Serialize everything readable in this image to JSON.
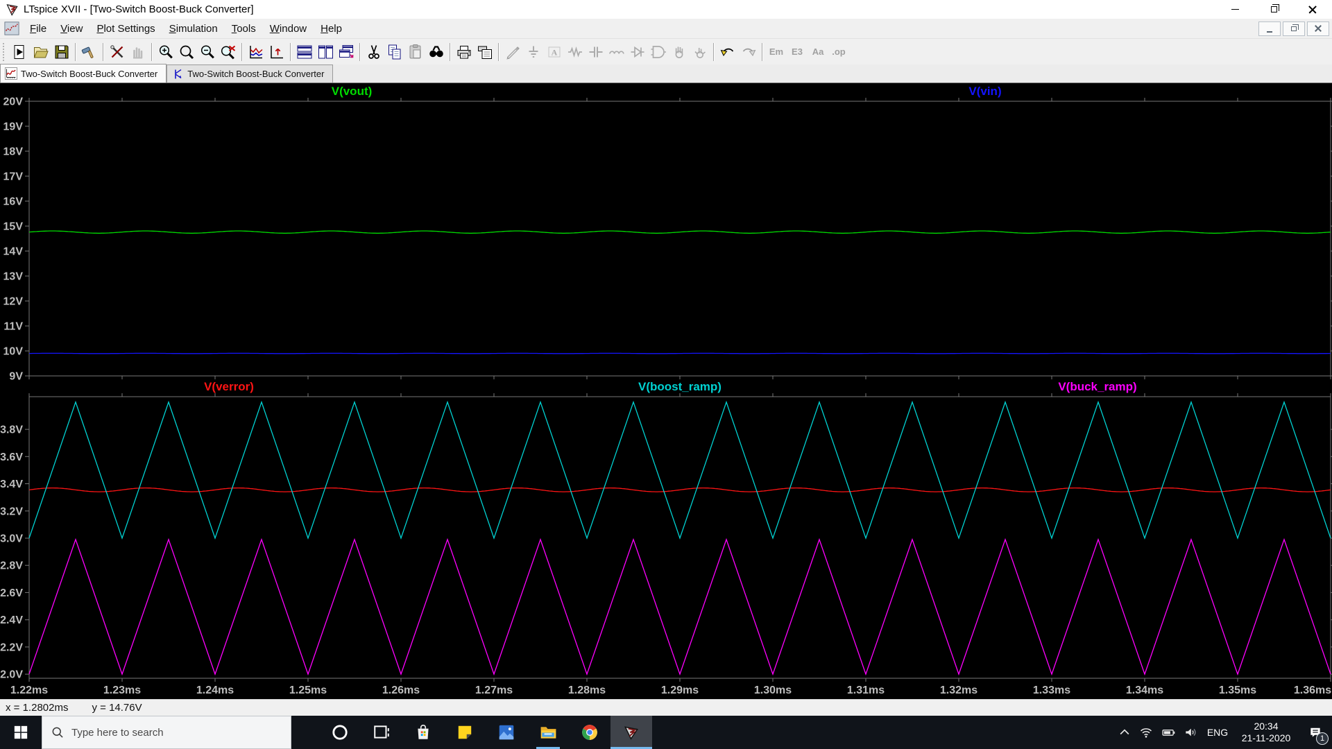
{
  "window": {
    "title": "LTspice XVII - [Two-Switch Boost-Buck Converter]",
    "controls": [
      "minimize",
      "restore",
      "close"
    ]
  },
  "menu_bar": {
    "items": [
      "File",
      "View",
      "Plot Settings",
      "Simulation",
      "Tools",
      "Window",
      "Help"
    ],
    "child_controls": [
      "minimize",
      "restore",
      "close"
    ]
  },
  "toolbar": {
    "groups": [
      [
        {
          "name": "run",
          "enabled": true
        },
        {
          "name": "open",
          "enabled": true
        },
        {
          "name": "save",
          "enabled": true
        }
      ],
      [
        {
          "name": "control-panel",
          "enabled": true
        }
      ],
      [
        {
          "name": "edit-tools",
          "enabled": true
        },
        {
          "name": "halt",
          "enabled": false
        }
      ],
      [
        {
          "name": "zoom-in",
          "enabled": true
        },
        {
          "name": "zoom-back",
          "enabled": true
        },
        {
          "name": "zoom-out",
          "enabled": true
        },
        {
          "name": "zoom-full-extents",
          "enabled": true
        }
      ],
      [
        {
          "name": "autorange-y-axis",
          "enabled": true
        },
        {
          "name": "pan-axes",
          "enabled": true
        }
      ],
      [
        {
          "name": "tile-horizontal",
          "enabled": true
        },
        {
          "name": "tile-vertical",
          "enabled": true
        },
        {
          "name": "cascade-windows",
          "enabled": true
        }
      ],
      [
        {
          "name": "cut",
          "enabled": true
        },
        {
          "name": "copy",
          "enabled": true
        },
        {
          "name": "paste",
          "enabled": false
        },
        {
          "name": "find",
          "enabled": true
        }
      ],
      [
        {
          "name": "print",
          "enabled": true
        },
        {
          "name": "print-preview",
          "enabled": true
        }
      ],
      [
        {
          "name": "wire",
          "enabled": false
        },
        {
          "name": "ground",
          "enabled": false
        },
        {
          "name": "net-label",
          "enabled": false
        },
        {
          "name": "resistor",
          "enabled": false
        },
        {
          "name": "capacitor",
          "enabled": false
        },
        {
          "name": "inductor",
          "enabled": false
        },
        {
          "name": "diode",
          "enabled": false
        },
        {
          "name": "component",
          "enabled": false
        },
        {
          "name": "move",
          "enabled": false
        },
        {
          "name": "drag",
          "enabled": false
        }
      ],
      [
        {
          "name": "undo",
          "enabled": true
        },
        {
          "name": "redo",
          "enabled": false
        }
      ],
      [
        {
          "name": "move-text",
          "enabled": false,
          "text": "Em"
        },
        {
          "name": "edit-text",
          "enabled": false,
          "text": "E3"
        },
        {
          "name": "text",
          "enabled": false,
          "text": "Aa"
        },
        {
          "name": "spice-directive",
          "enabled": false,
          "text": ".op"
        }
      ]
    ]
  },
  "tabs": [
    {
      "label": "Two-Switch Boost-Buck Converter",
      "type": "waveform",
      "active": true
    },
    {
      "label": "Two-Switch Boost-Buck Converter",
      "type": "schematic",
      "active": false
    }
  ],
  "chart_data": [
    {
      "type": "line",
      "x_axis": {
        "unit": "ms",
        "min": 1.22,
        "max": 1.36,
        "tick_step": 0.01,
        "labels": []
      },
      "y_axis": {
        "min": 9,
        "max": 20,
        "ticks": [
          {
            "label": "20V",
            "value": 20
          },
          {
            "label": "19V",
            "value": 19
          },
          {
            "label": "18V",
            "value": 18
          },
          {
            "label": "17V",
            "value": 17
          },
          {
            "label": "16V",
            "value": 16
          },
          {
            "label": "15V",
            "value": 15
          },
          {
            "label": "14V",
            "value": 14
          },
          {
            "label": "13V",
            "value": 13
          },
          {
            "label": "12V",
            "value": 12
          },
          {
            "label": "11V",
            "value": 11
          },
          {
            "label": "10V",
            "value": 10
          },
          {
            "label": "9V",
            "value": 9
          }
        ]
      },
      "series": [
        {
          "name": "V(vout)",
          "color": "#00dc00",
          "kind": "flat",
          "value": 14.76,
          "ripple": 0.045,
          "ripple_period_ms": 0.01
        },
        {
          "name": "V(vin)",
          "color": "#1414ff",
          "kind": "flat",
          "value": 9.9,
          "ripple": 0.006,
          "ripple_period_ms": 0.01
        }
      ]
    },
    {
      "type": "line",
      "x_axis": {
        "unit": "ms",
        "min": 1.22,
        "max": 1.36,
        "tick_step": 0.01,
        "labels": [
          "1.22ms",
          "1.23ms",
          "1.24ms",
          "1.25ms",
          "1.26ms",
          "1.27ms",
          "1.28ms",
          "1.29ms",
          "1.30ms",
          "1.31ms",
          "1.32ms",
          "1.33ms",
          "1.34ms",
          "1.35ms",
          "1.36ms"
        ]
      },
      "y_axis": {
        "min": 1.97,
        "max": 4.04,
        "ticks": [
          {
            "label": "3.8V",
            "value": 3.8
          },
          {
            "label": "3.6V",
            "value": 3.6
          },
          {
            "label": "3.4V",
            "value": 3.4
          },
          {
            "label": "3.2V",
            "value": 3.2
          },
          {
            "label": "3.0V",
            "value": 3.0
          },
          {
            "label": "2.8V",
            "value": 2.8
          },
          {
            "label": "2.6V",
            "value": 2.6
          },
          {
            "label": "2.4V",
            "value": 2.4
          },
          {
            "label": "2.2V",
            "value": 2.2
          },
          {
            "label": "2.0V",
            "value": 2.0
          }
        ]
      },
      "series": [
        {
          "name": "V(verror)",
          "color": "#ff1414",
          "kind": "flat",
          "value": 3.355,
          "ripple": 0.014,
          "ripple_period_ms": 0.01
        },
        {
          "name": "V(boost_ramp)",
          "color": "#00d2d2",
          "kind": "triangle",
          "min": 3.0,
          "max": 4.0,
          "period_ms": 0.01,
          "start_ms": 1.22
        },
        {
          "name": "V(buck_ramp)",
          "color": "#ff00ff",
          "kind": "triangle",
          "min": 2.0,
          "max": 2.99,
          "period_ms": 0.01,
          "start_ms": 1.22
        }
      ]
    }
  ],
  "status_bar": {
    "x_readout": "x = 1.2802ms",
    "y_readout": "y = 14.76V"
  },
  "taskbar": {
    "search_placeholder": "Type here to search",
    "pinned": [
      {
        "name": "cortana"
      },
      {
        "name": "task-view"
      },
      {
        "name": "store"
      },
      {
        "name": "sticky-notes"
      },
      {
        "name": "photos"
      },
      {
        "name": "file-explorer",
        "running": true
      },
      {
        "name": "chrome"
      },
      {
        "name": "ltspice",
        "running": true,
        "active": true
      }
    ],
    "tray": {
      "language": "ENG",
      "time": "20:34",
      "date": "21-11-2020",
      "notification_count": "1"
    }
  }
}
